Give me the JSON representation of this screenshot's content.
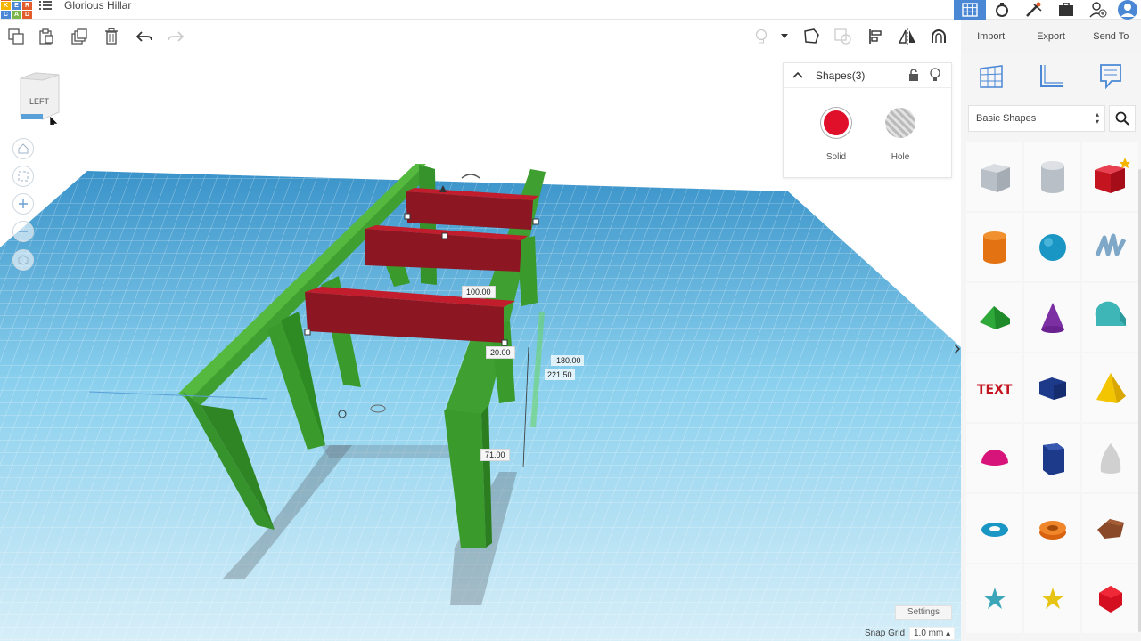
{
  "app": {
    "logo_letters": [
      "T",
      "I",
      "N",
      "K",
      "E",
      "R",
      "C",
      "A",
      "D"
    ],
    "logo_colors": [
      "#e35c2c",
      "#7ab648",
      "#4a88d6",
      "#f5b400",
      "#4a88d6",
      "#e35c2c",
      "#4a88d6",
      "#7ab648",
      "#e35c2c"
    ],
    "doc_title": "Glorious Hillar"
  },
  "toolbar": {
    "copy_icon": "copy-icon",
    "paste_icon": "paste-icon",
    "duplicate_icon": "duplicate-icon",
    "delete_icon": "trash-icon",
    "undo_icon": "undo-icon",
    "redo_icon": "redo-icon"
  },
  "actions": {
    "import": "Import",
    "export": "Export",
    "send_to": "Send To"
  },
  "viewcube": {
    "face": "LEFT"
  },
  "inspector": {
    "title": "Shapes(3)",
    "solid_label": "Solid",
    "hole_label": "Hole",
    "solid_color": "#e0102a"
  },
  "dimensions": {
    "width": "100.00",
    "depth": "20.00",
    "elevation": "-180.00",
    "height": "221.50",
    "length": "71.00"
  },
  "settings": {
    "label": "Settings",
    "snap_grid_label": "Snap Grid",
    "snap_grid_value": "1.0 mm ▴"
  },
  "library": {
    "selected": "Basic Shapes"
  },
  "colors": {
    "accent": "#4a88d6",
    "frame_green": "#3a9a2c",
    "beam_red": "#8c1622",
    "grid_blue": "#6fc4ea"
  }
}
